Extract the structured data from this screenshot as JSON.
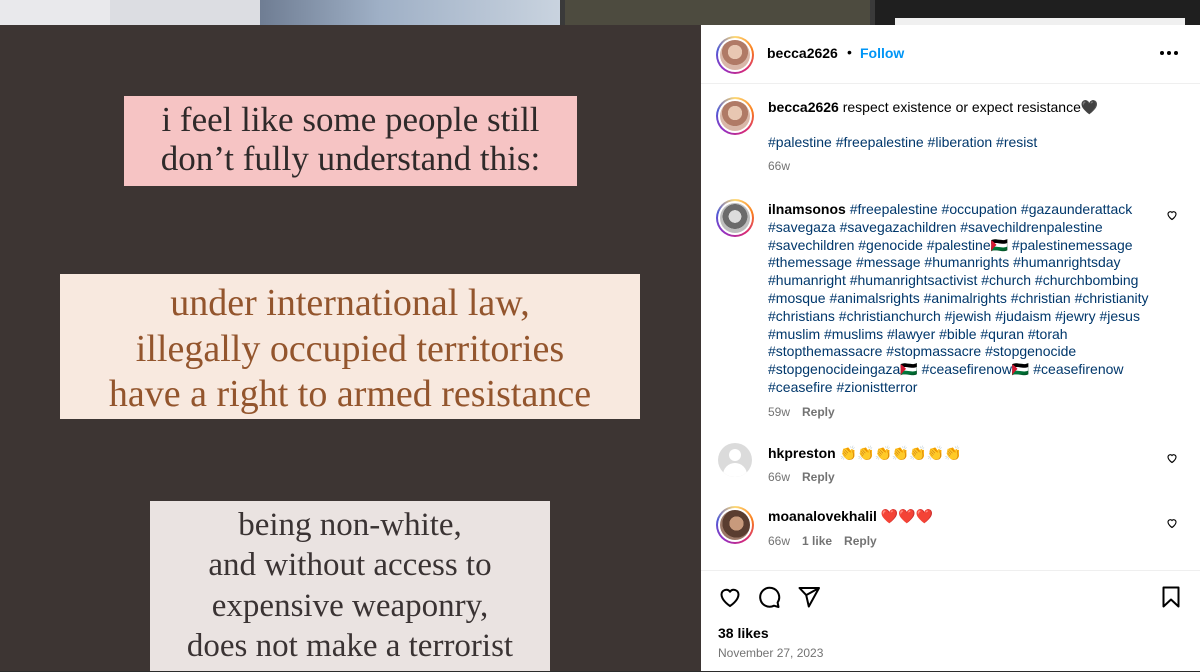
{
  "image": {
    "lines_1": [
      "i feel like some people still",
      "don’t fully understand this:"
    ],
    "lines_2": [
      "under international law,",
      "illegally occupied territories",
      "have a right to armed resistance"
    ],
    "lines_3": [
      "being non-white,",
      "and without access to",
      "expensive weaponry,",
      "does not make a terrorist"
    ]
  },
  "header": {
    "username": "becca2626",
    "separator": "•",
    "follow_label": "Follow"
  },
  "caption": {
    "username": "becca2626",
    "text": "respect existence or expect resistance🖤",
    "hashtags": "#palestine #freepalestine #liberation #resist",
    "time": "66w"
  },
  "comments": [
    {
      "username": "ilnamsonos",
      "text": "#freepalestine #occupation #gazaunderattack #savegaza #savegazachildren #savechildrenpalestine #savechildren #genocide #palestine🇵🇸 #palestinemessage #themessage #message #humanrights #humanrightsday #humanright #humanrightsactivist #church #churchbombing #mosque #animalsrights #animalrights #christian #christianity #christians #christianchurch #jewish #judaism #jewry #jesus #muslim #muslims #lawyer #bible #quran #torah #stopthemassacre #stopmassacre #stopgenocide #stopgenocideingaza🇵🇸 #ceasefirenow🇵🇸 #ceasefirenow #ceasefire #zionistterror",
      "time": "59w",
      "reply": "Reply"
    },
    {
      "username": "hkpreston",
      "text": "👏👏👏👏👏👏👏",
      "time": "66w",
      "reply": "Reply"
    },
    {
      "username": "moanalovekhalil",
      "text": "❤️❤️❤️",
      "time": "66w",
      "likes": "1 like",
      "reply": "Reply"
    }
  ],
  "footer": {
    "likes": "38 likes",
    "date": "November 27, 2023"
  },
  "icons": [
    "more-icon",
    "heart-icon",
    "comment-icon",
    "share-icon",
    "bookmark-icon"
  ],
  "colors": {
    "follow": "#0095f6",
    "hashtag": "#00376b",
    "muted": "#737373",
    "image_bg": "#3d3533"
  }
}
